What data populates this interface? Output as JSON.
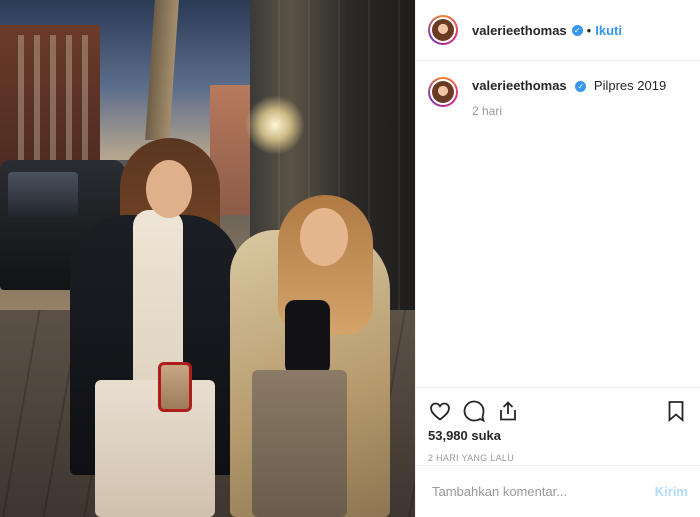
{
  "header": {
    "username": "valerieethomas",
    "verified_glyph": "✓",
    "separator": "•",
    "follow_label": "Ikuti",
    "more_glyph": ""
  },
  "caption": {
    "username": "valerieethomas",
    "verified_glyph": "✓",
    "text": "Pilpres 2019",
    "time": "2 hari"
  },
  "actions": {
    "icons": [
      "heart-icon",
      "comment-icon",
      "share-icon",
      "bookmark-icon"
    ],
    "likes": "53,980 suka",
    "posted_ago": "2 HARI YANG LALU"
  },
  "comment": {
    "placeholder": "Tambahkan komentar...",
    "send_label": "Kirim"
  },
  "colors": {
    "accent": "#3897f0",
    "send_disabled": "#b3dbff"
  }
}
